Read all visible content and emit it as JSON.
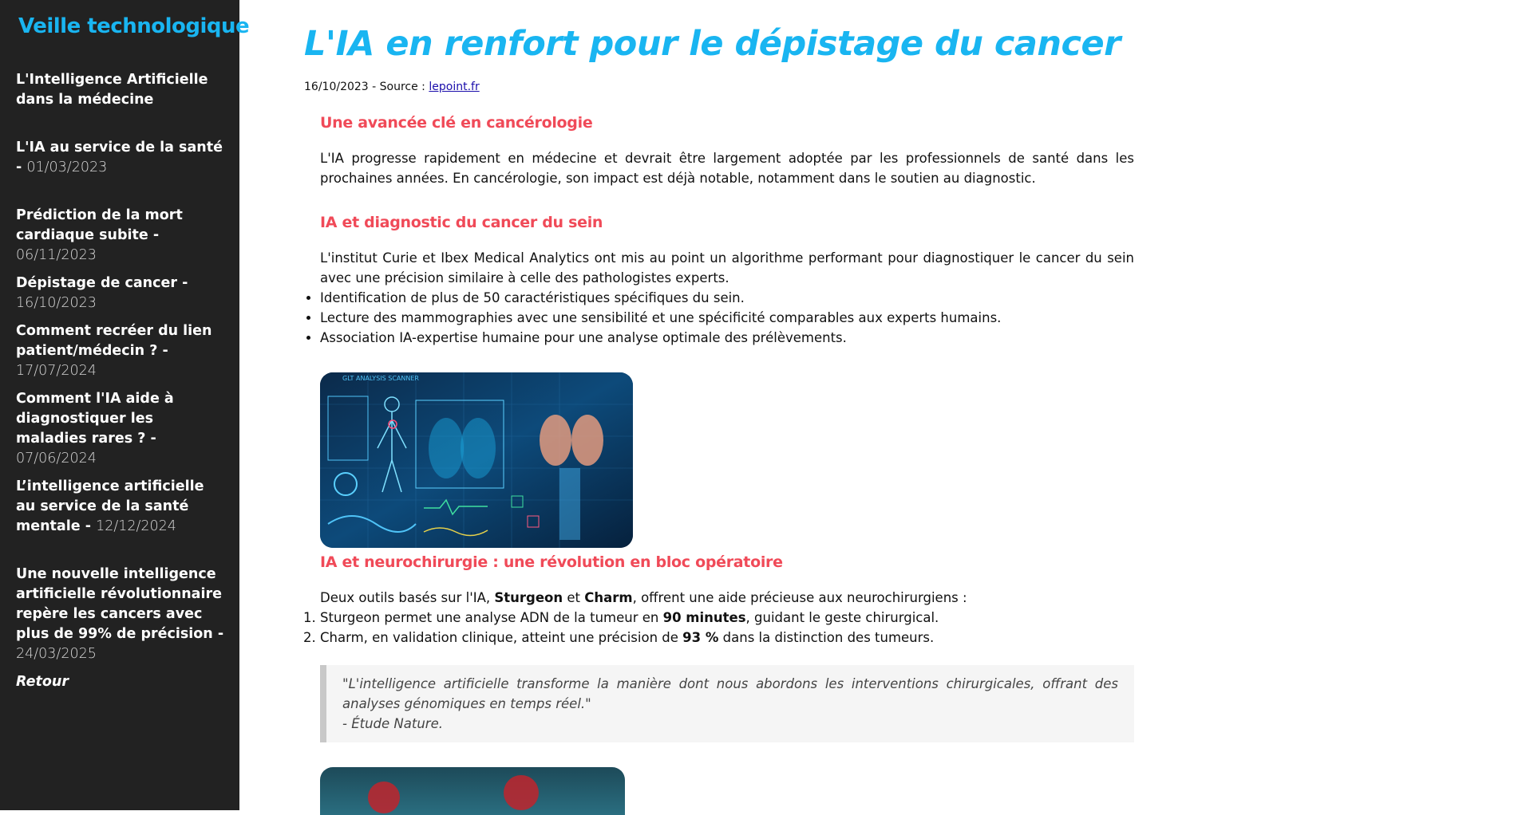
{
  "sidebar": {
    "brand": "Veille technologique",
    "items": [
      {
        "label": "L'Intelligence Artificielle dans la médecine",
        "date": ""
      },
      {
        "label": "L'IA au service de la santé -",
        "date": "01/03/2023"
      },
      {
        "label": "Prédiction de la mort cardiaque subite -",
        "date": "06/11/2023"
      },
      {
        "label": "Dépistage de cancer -",
        "date": "16/10/2023"
      },
      {
        "label": "Comment recréer du lien patient/médecin ? -",
        "date": "17/07/2024"
      },
      {
        "label": "Comment l'IA aide à diagnostiquer les maladies rares ? -",
        "date": "07/06/2024"
      },
      {
        "label": "L’intelligence artificielle au service de la santé mentale -",
        "date": "12/12/2024"
      },
      {
        "label": "Une nouvelle intelligence artificielle révolutionnaire repère les cancers avec plus de 99% de précision -",
        "date": "24/03/2025"
      }
    ],
    "back_label": "Retour"
  },
  "article": {
    "title": "L'IA en renfort pour le dépistage du cancer",
    "meta_prefix": "16/10/2023 - Source : ",
    "source_link": "lepoint.fr",
    "section1": {
      "heading": "Une avancée clé en cancérologie",
      "text": "L'IA progresse rapidement en médecine et devrait être largement adoptée par les professionnels de santé dans les prochaines années. En cancérologie, son impact est déjà notable, notamment dans le soutien au diagnostic."
    },
    "section2": {
      "heading": "IA et diagnostic du cancer du sein",
      "text": "L'institut Curie et Ibex Medical Analytics ont mis au point un algorithme performant pour diagnostiquer le cancer du sein avec une précision similaire à celle des pathologistes experts.",
      "bullets": [
        "Identification de plus de 50 caractéristiques spécifiques du sein.",
        "Lecture des mammographies avec une sensibilité et une spécificité comparables aux experts humains.",
        "Association IA-expertise humaine pour une analyse optimale des prélèvements."
      ],
      "image_label": "GLT ANALYSIS SCANNER"
    },
    "section3": {
      "heading": "IA et neurochirurgie : une révolution en bloc opératoire",
      "intro_before": "Deux outils basés sur l'IA, ",
      "intro_tool1": "Sturgeon",
      "intro_mid": " et ",
      "intro_tool2": "Charm",
      "intro_after": ", offrent une aide précieuse aux neurochirurgiens :",
      "list": [
        {
          "before": "Sturgeon permet une analyse ADN de la tumeur en ",
          "bold": "90 minutes",
          "after": ", guidant le geste chirurgical."
        },
        {
          "before": "Charm, en validation clinique, atteint une précision de ",
          "bold": "93 %",
          "after": " dans la distinction des tumeurs."
        }
      ],
      "quote": "\"L'intelligence artificielle transforme la manière dont nous abordons les interventions chirurgicales, offrant des analyses génomiques en temps réel.\"",
      "quote_author": "- Étude Nature."
    }
  },
  "colors": {
    "sidebar_bg": "#222222",
    "accent_blue": "#19b5f1",
    "heading_red": "#f04a58"
  }
}
